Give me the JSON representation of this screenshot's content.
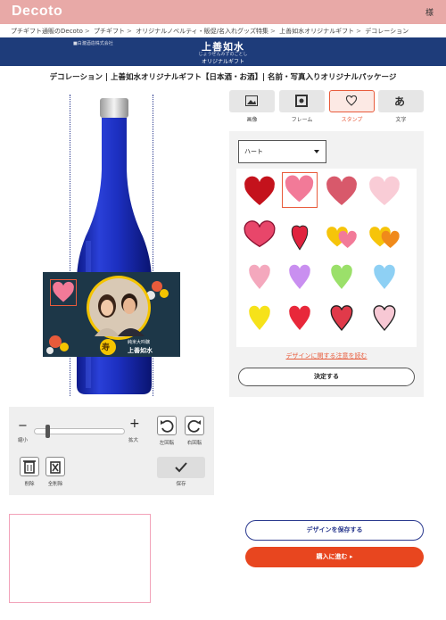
{
  "header": {
    "logo": "Decoto",
    "right_text": "様"
  },
  "breadcrumb": [
    "プチギフト通販のDecoto",
    "プチギフト",
    "オリジナルノベルティ・販促/名入れグッズ特集",
    "上善如水オリジナルギフト",
    "デコレーション"
  ],
  "banner": {
    "corp": "■白瀧酒造株式会社",
    "brand": "上善如水",
    "brand_reading": "じょうぜんみずのごとし",
    "sub": "オリジナルギフト"
  },
  "page_title": "デコレーション | 上善如水オリジナルギフト【日本酒・お酒】| 名前・写真入りオリジナルパッケージ",
  "label": {
    "vertical_text": "純米大吟醸",
    "brand": "上善如水",
    "kotobuki": "寿"
  },
  "tool_tabs": [
    {
      "label": "画像",
      "icon": "image-icon",
      "active": false
    },
    {
      "label": "フレーム",
      "icon": "frame-icon",
      "active": false
    },
    {
      "label": "スタンプ",
      "icon": "heart-icon",
      "active": true
    },
    {
      "label": "文字",
      "icon": "text-icon",
      "active": false
    }
  ],
  "stamp_panel": {
    "category_selected": "ハート",
    "notice_link": "デザインに関する注意を読む",
    "decide_button": "決定する"
  },
  "controls": {
    "zoom_out_symbol": "−",
    "zoom_in_symbol": "+",
    "zoom_out": "縮小",
    "zoom_in": "拡大",
    "zoom_level": 0.12,
    "rotate_left": "左回転",
    "rotate_right": "右回転",
    "delete": "削除",
    "delete_all": "全削除",
    "save": "保存"
  },
  "actions": {
    "save_design": "デザインを保存する",
    "proceed": "購入に進む ▸"
  },
  "colors": {
    "accent": "#e85b3b",
    "navy": "#1e3c7a",
    "header_pink": "#e8a9a7",
    "bottle_blue": "#1f2fb0"
  }
}
